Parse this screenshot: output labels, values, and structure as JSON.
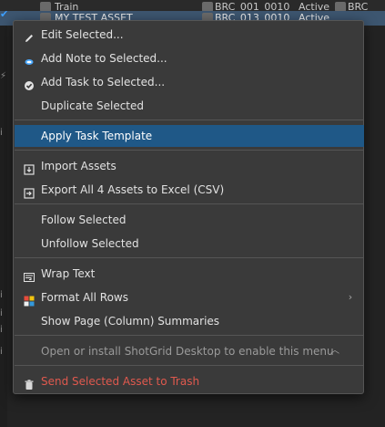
{
  "background": {
    "row1": {
      "name": "Train",
      "link": "BRC_001_0010",
      "status": "Active",
      "link2": "BRC_"
    },
    "row2": {
      "name": "MY TEST ASSET",
      "link": "BRC_013_0010",
      "status": "Active"
    }
  },
  "menu": {
    "items": [
      {
        "label": "Edit Selected...",
        "icon": "pencil-icon"
      },
      {
        "label": "Add Note to Selected...",
        "icon": "note-bubble-icon"
      },
      {
        "label": "Add Task to Selected...",
        "icon": "task-check-icon"
      },
      {
        "label": "Duplicate Selected"
      },
      {
        "label": "Apply Task Template",
        "highlighted": true
      },
      {
        "label": "Import Assets",
        "icon": "import-icon"
      },
      {
        "label": "Export All 4 Assets to Excel (CSV)",
        "icon": "export-icon"
      },
      {
        "label": "Follow Selected"
      },
      {
        "label": "Unfollow Selected"
      },
      {
        "label": "Wrap Text",
        "icon": "wrap-text-icon"
      },
      {
        "label": "Format All Rows",
        "icon": "format-grid-icon",
        "submenu": true
      },
      {
        "label": "Show Page (Column) Summaries"
      },
      {
        "label": "Open or install ShotGrid Desktop to enable this menu",
        "disabled": true
      },
      {
        "label": "Send Selected Asset to Trash",
        "icon": "trash-icon",
        "danger": true
      }
    ]
  },
  "colors": {
    "highlight": "#1f5887",
    "danger": "#e0594e",
    "menu_bg": "#3a3a3a",
    "disabled": "#9a9a9a"
  }
}
